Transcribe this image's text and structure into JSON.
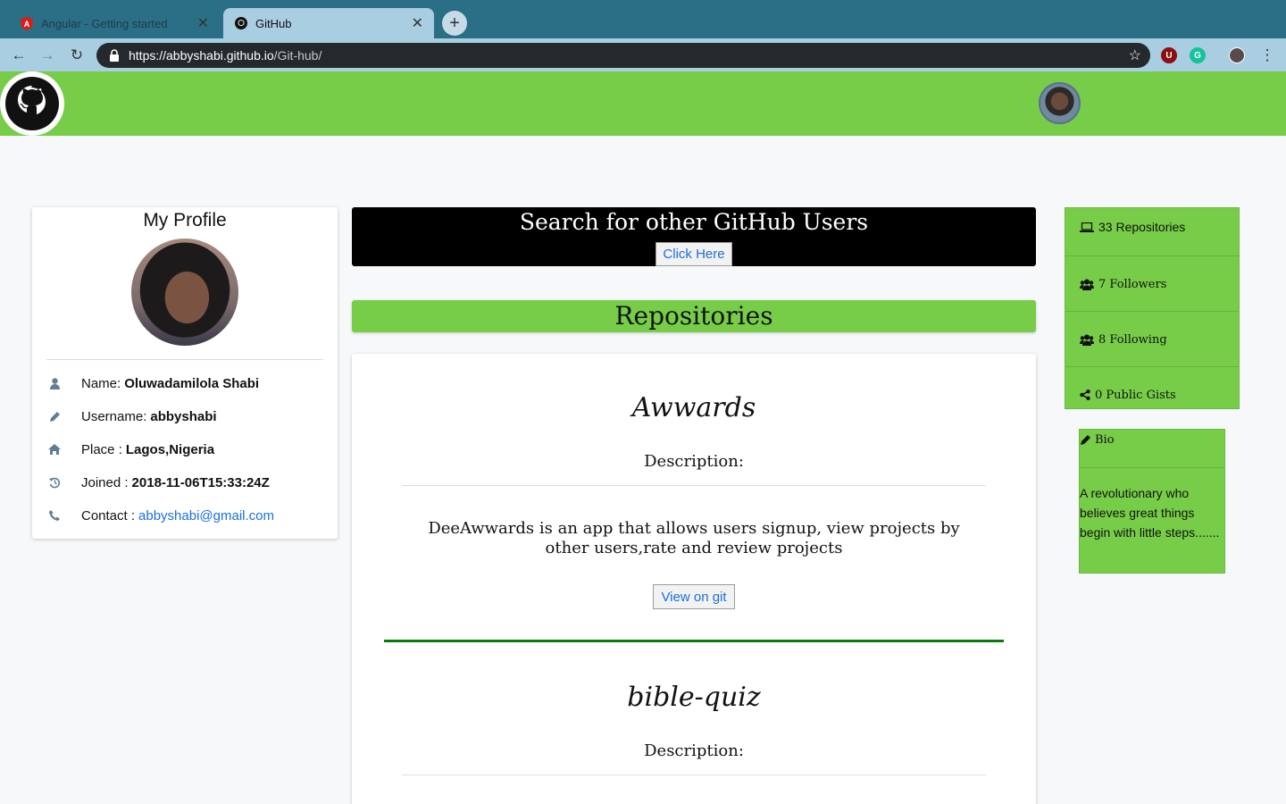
{
  "browser": {
    "tabs": [
      {
        "title": "Angular - Getting started",
        "icon": "angular-icon",
        "active": false
      },
      {
        "title": "GitHub",
        "icon": "github-icon",
        "active": true
      }
    ],
    "url_host": "https://abbyshabi.github.io",
    "url_path": "/Git-hub/"
  },
  "profile": {
    "heading": "My Profile",
    "name_label": "Name:",
    "name": "Oluwadamilola Shabi",
    "username_label": "Username:",
    "username": "abbyshabi",
    "place_label": "Place :",
    "place": "Lagos,Nigeria",
    "joined_label": "Joined :",
    "joined": "2018-11-06T15:33:24Z",
    "contact_label": "Contact :",
    "contact": "abbyshabi@gmail.com"
  },
  "search": {
    "title": "Search for other GitHub Users",
    "button": "Click Here"
  },
  "repos": {
    "heading": "Repositories",
    "items": [
      {
        "name": "Awwards",
        "desc_label": "Description:",
        "description": "DeeAwwards is an app that allows users signup, view projects by other users,rate and review projects",
        "button": "View on git"
      },
      {
        "name": "bible-quiz",
        "desc_label": "Description:"
      }
    ]
  },
  "stats": {
    "repositories": "33 Repositories",
    "followers": "7 Followers",
    "following": "8 Following",
    "gists": "0 Public Gists"
  },
  "bio": {
    "heading": "Bio",
    "text": "A revolutionary who believes great things begin with little steps......."
  },
  "colors": {
    "accent_green": "#77cd48",
    "link_blue": "#1a6fe0",
    "separator_green": "#0a7a0a"
  }
}
